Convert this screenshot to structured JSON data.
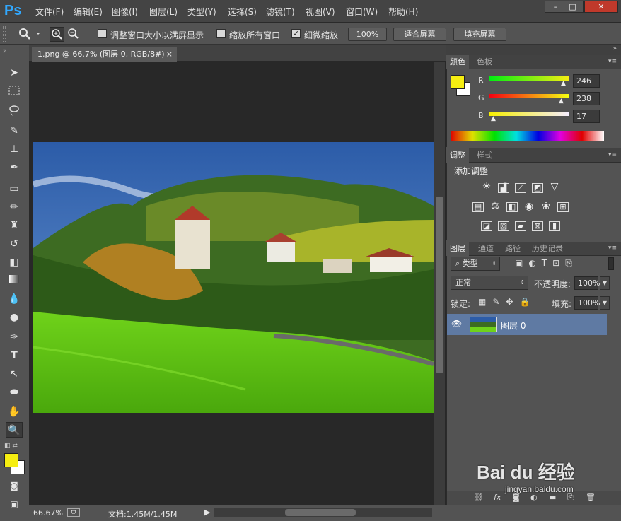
{
  "app": {
    "logo": "Ps"
  },
  "menu": [
    "文件(F)",
    "编辑(E)",
    "图像(I)",
    "图层(L)",
    "类型(Y)",
    "选择(S)",
    "滤镜(T)",
    "视图(V)",
    "窗口(W)",
    "帮助(H)"
  ],
  "window_controls": {
    "minimize": "–",
    "restore": "□",
    "close": "✕"
  },
  "options": {
    "resize_windows_label": "调整窗口大小以满屏显示",
    "resize_windows_checked": false,
    "zoom_all_label": "缩放所有窗口",
    "zoom_all_checked": false,
    "scrubby_label": "细微缩放",
    "scrubby_checked": true,
    "zoom100": "100%",
    "fit_screen": "适合屏幕",
    "fill_screen": "填充屏幕"
  },
  "document": {
    "tab_title": "1.png @ 66.7% (图层 0, RGB/8#)",
    "tab_close": "×"
  },
  "status": {
    "zoom": "66.67%",
    "doc_info": "文档:1.45M/1.45M"
  },
  "color_panel": {
    "tabs": [
      "颜色",
      "色板"
    ],
    "foreground": "#f6ee11",
    "background": "#ffffff",
    "channels": [
      {
        "label": "R",
        "value": "246"
      },
      {
        "label": "G",
        "value": "238"
      },
      {
        "label": "B",
        "value": "17"
      }
    ]
  },
  "adjust_panel": {
    "tabs": [
      "调整",
      "样式"
    ],
    "title": "添加调整"
  },
  "layers_panel": {
    "tabs": [
      "图层",
      "通道",
      "路径",
      "历史记录"
    ],
    "filter_kind": "类型",
    "blend_mode": "正常",
    "opacity_label": "不透明度:",
    "opacity": "100%",
    "lock_label": "锁定:",
    "fill_label": "填充:",
    "fill": "100%",
    "layers": [
      {
        "name": "图层 0",
        "visible": true
      }
    ]
  },
  "watermark": {
    "brand": "Bai du 经验",
    "url": "jingyan.baidu.com"
  }
}
